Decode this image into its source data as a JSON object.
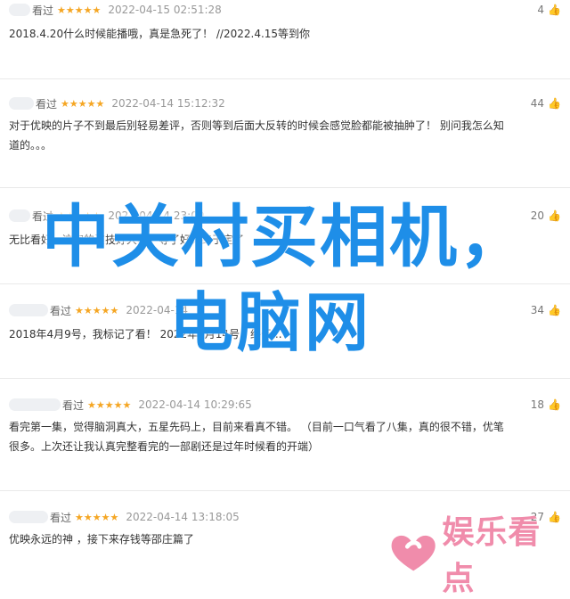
{
  "reviews": [
    {
      "tag": "看过",
      "stars": "★★★★★",
      "time": "2022-04-15 02:51:28",
      "likes": "4",
      "lines": [
        "2018.4.20什么时候能播哦，真是急死了！ //2022.4.15等到你"
      ]
    },
    {
      "tag": "看过",
      "stars": "★★★★★",
      "time": "2022-04-14 15:12:32",
      "likes": "44",
      "lines": [
        "对于优映的片子不到最后别轻易差评，否则等到后面大反转的时候会感觉脸都能被抽肿了！  别问我怎么知",
        "道的。。。"
      ]
    },
    {
      "tag": "看过",
      "stars": "★★★★★",
      "time": "2022-04-14 23:09",
      "likes": "20",
      "lines": [
        "无比看好，这家的演技好大啊，等了好久终于定了"
      ]
    },
    {
      "tag": "看过",
      "stars": "★★★★★",
      "time": "2022-04-14",
      "likes": "34",
      "lines": [
        "2018年4月9号，我标记了看！ 2022年4月14号，终于..."
      ]
    },
    {
      "tag": "看过",
      "stars": "★★★★★",
      "time": "2022-04-14 10:29:65",
      "likes": "18",
      "lines": [
        "看完第一集，觉得脑洞真大，五星先码上，目前来看真不错。  （目前一口气看了八集，真的很不错，优笔",
        "很多。上次还让我认真完整看完的一部剧还是过年时候看的开端）"
      ]
    },
    {
      "tag": "看过",
      "stars": "★★★★★",
      "time": "2022-04-14 13:18:05",
      "likes": "27",
      "lines": [
        "优映永远的神 ，接下来存钱等邵庄篇了"
      ]
    }
  ],
  "watermark": {
    "title": "中关村买相机，",
    "subtitle": "电脑网"
  },
  "brand": {
    "text": "娱乐看点",
    "icon": "heart-logo-icon"
  },
  "colors": {
    "star": "#f5a623",
    "watermark": "#1e8ee8",
    "brand": "#f08cab"
  }
}
